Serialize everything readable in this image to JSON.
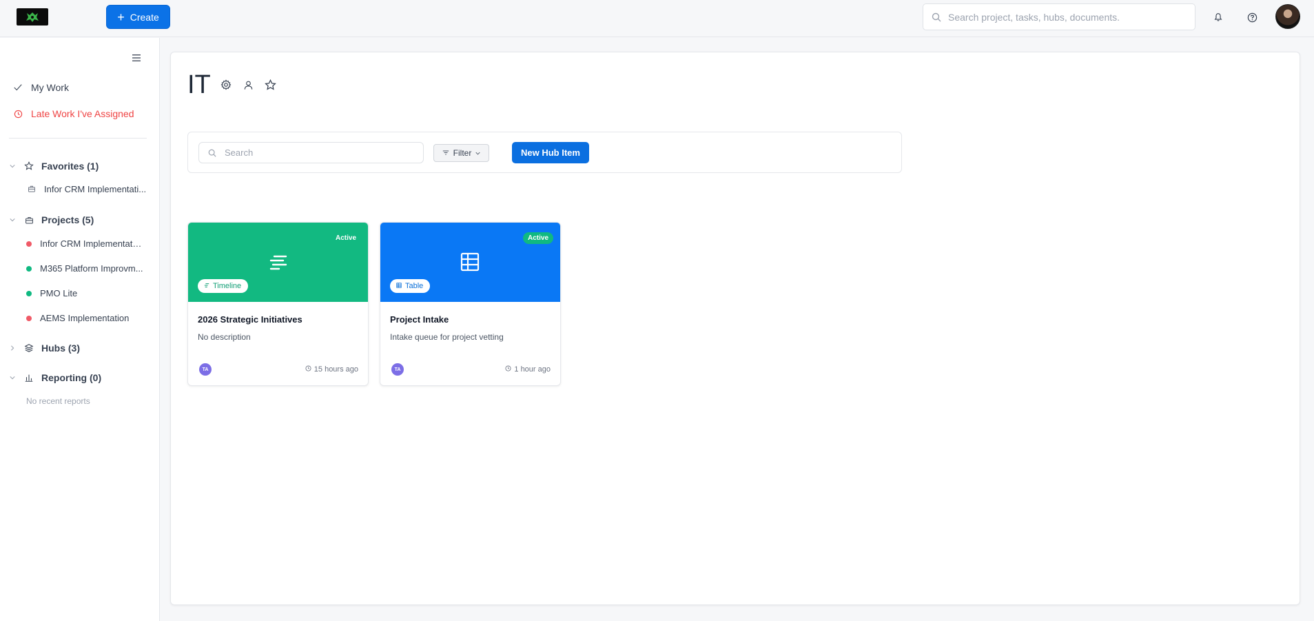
{
  "header": {
    "create_label": "Create",
    "search_placeholder": "Search project, tasks, hubs, documents."
  },
  "sidebar": {
    "my_work": "My Work",
    "late_work": "Late Work I've Assigned",
    "favorites": {
      "label": "Favorites (1)",
      "items": [
        "Infor CRM Implementati..."
      ]
    },
    "projects": {
      "label": "Projects (5)",
      "items": [
        {
          "label": "Infor CRM Implementation",
          "color": "#f05a67"
        },
        {
          "label": "M365 Platform Improvm...",
          "color": "#10b981"
        },
        {
          "label": "PMO Lite",
          "color": "#10b981"
        },
        {
          "label": "AEMS Implementation",
          "color": "#f05a67"
        }
      ]
    },
    "hubs": {
      "label": "Hubs (3)"
    },
    "reporting": {
      "label": "Reporting (0)",
      "empty": "No recent reports"
    }
  },
  "main": {
    "title": "IT",
    "toolbar": {
      "search_placeholder": "Search",
      "filter_label": "Filter",
      "new_hub_label": "New Hub Item"
    },
    "cards": [
      {
        "status": "Active",
        "type": "Timeline",
        "hero_color": "#12b981",
        "status_bg": "transparent",
        "pill_color": "#0f9e74",
        "title": "2026 Strategic Initiatives",
        "description": "No description",
        "avatar": "TA",
        "time": "15 hours ago"
      },
      {
        "status": "Active",
        "type": "Table",
        "hero_color": "#0a78f5",
        "status_bg": "#10b981",
        "pill_color": "#0a6fd8",
        "title": "Project Intake",
        "description": "Intake queue for project vetting",
        "avatar": "TA",
        "time": "1 hour ago"
      }
    ]
  }
}
